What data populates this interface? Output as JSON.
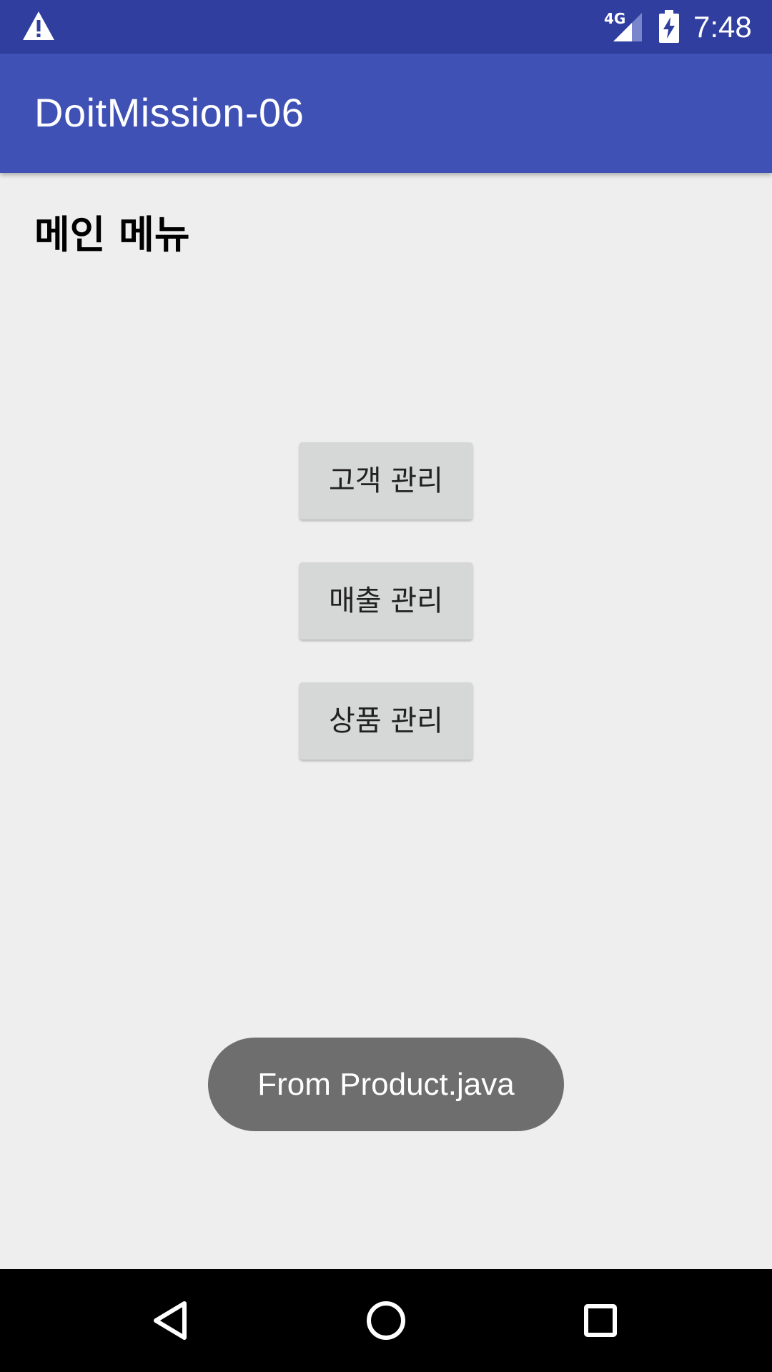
{
  "status_bar": {
    "time": "7:48",
    "network_label": "4G",
    "icons": [
      "warning-icon",
      "signal-icon",
      "battery-charging-icon"
    ],
    "color": "#303f9f"
  },
  "app_bar": {
    "title": "DoitMission-06",
    "color": "#3f51b5"
  },
  "main": {
    "heading": "메인 메뉴",
    "buttons": [
      {
        "label": "고객 관리"
      },
      {
        "label": "매출 관리"
      },
      {
        "label": "상품 관리"
      }
    ]
  },
  "toast": {
    "message": "From Product.java"
  },
  "nav_bar": {
    "icons": [
      "back-icon",
      "home-icon",
      "recents-icon"
    ]
  }
}
